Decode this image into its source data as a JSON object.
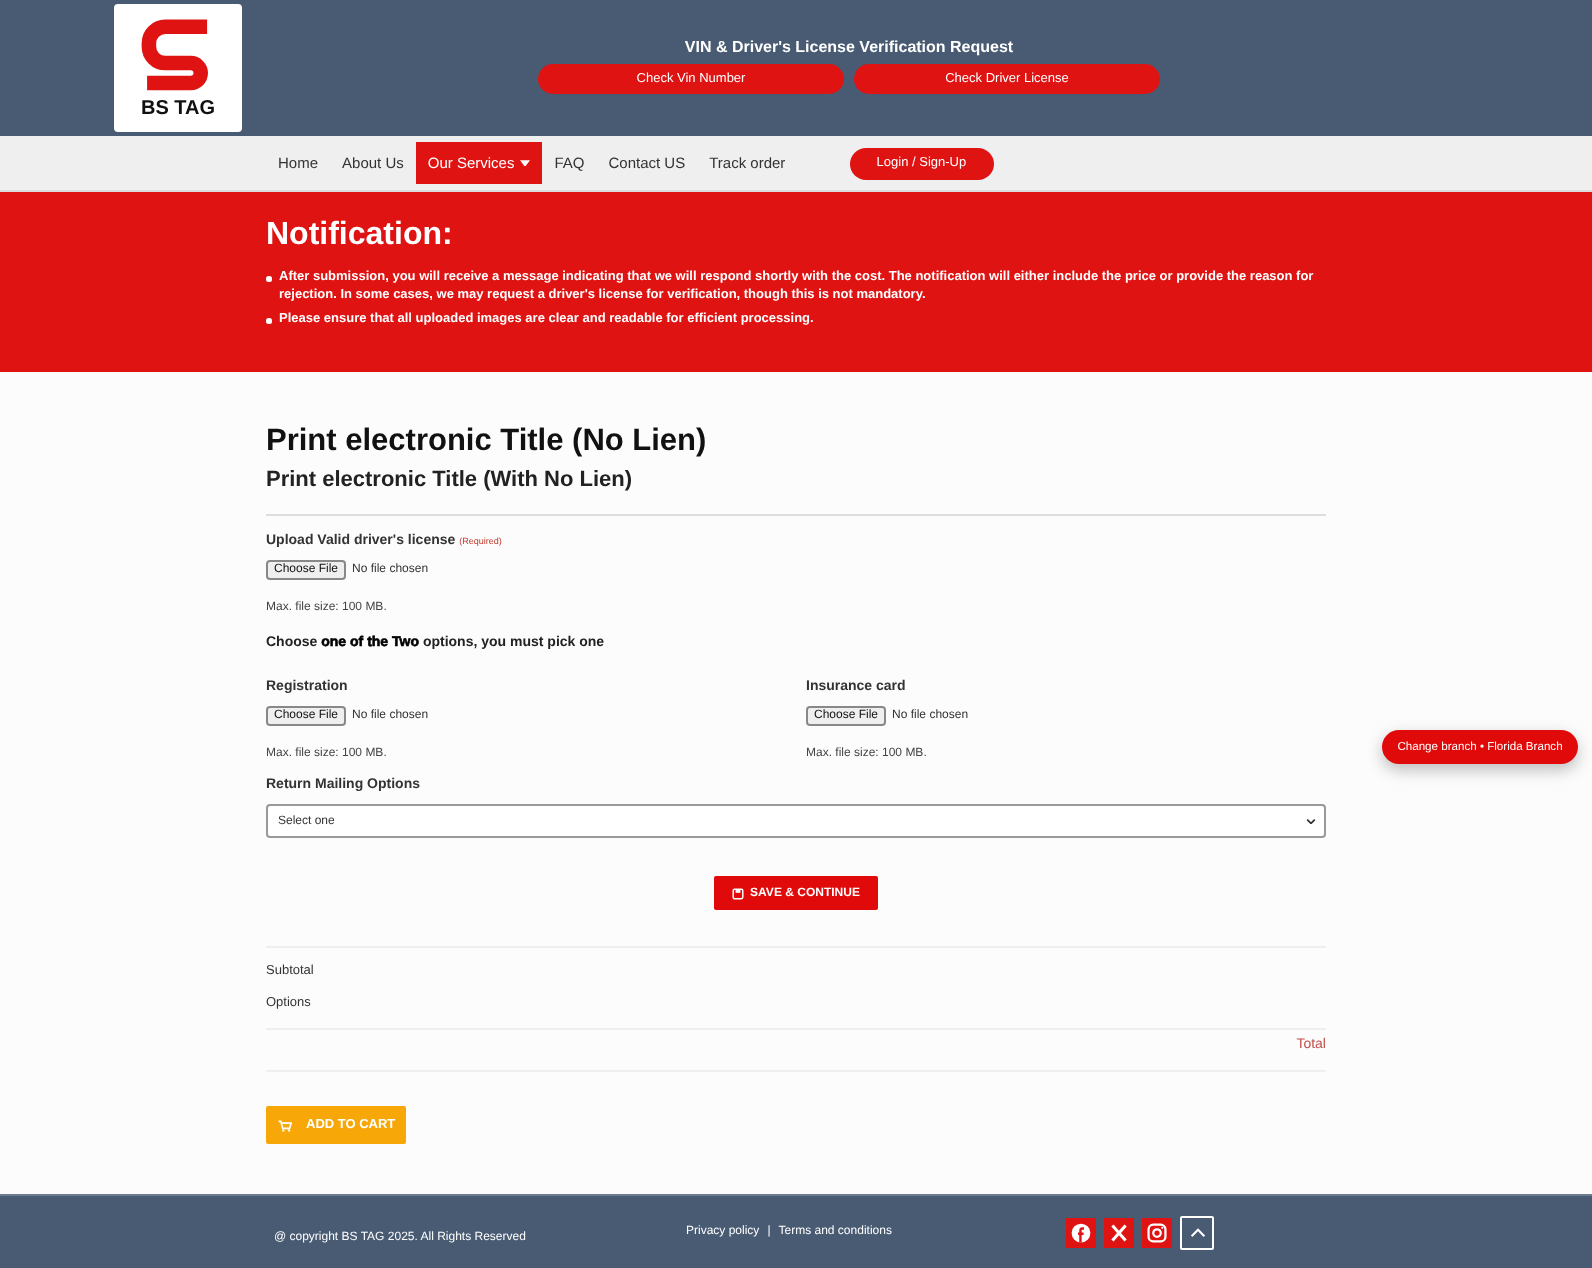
{
  "header": {
    "logo_text": "BS TAG",
    "title": "VIN & Driver's License Verification Request",
    "buttons": [
      "Check Vin Number",
      "Check Driver License"
    ]
  },
  "nav": {
    "items": [
      {
        "label": "Home",
        "selected": false,
        "has_dropdown": false
      },
      {
        "label": "About Us",
        "selected": false,
        "has_dropdown": false
      },
      {
        "label": "Our Services",
        "selected": true,
        "has_dropdown": true
      },
      {
        "label": "FAQ",
        "selected": false,
        "has_dropdown": false
      },
      {
        "label": "Contact US",
        "selected": false,
        "has_dropdown": false
      },
      {
        "label": "Track order",
        "selected": false,
        "has_dropdown": false
      }
    ],
    "login_button": "Login / Sign-Up"
  },
  "notification": {
    "title": "Notification:",
    "items": [
      "After submission, you will receive a message indicating that we will respond shortly with the cost. The notification will either include the price or provide the reason for rejection. In some cases, we may request a driver's license for verification, though this is not mandatory.",
      "Please ensure that all uploaded images are clear and readable for efficient processing."
    ]
  },
  "product": {
    "title": "Print electronic Title (No Lien)",
    "subtitle": "Print electronic Title (With No Lien)"
  },
  "license_upload": {
    "label": "Upload Valid driver's license",
    "required_note": "(Required)",
    "button": "Choose File",
    "status": "No file chosen",
    "hint": "Max. file size: 100 MB."
  },
  "choice_note": "Choose **one of the Two** options, you must pick one",
  "choice_uploads": [
    {
      "label": "Registration",
      "button": "Choose File",
      "status": "No file chosen",
      "hint": "Max. file size: 100 MB."
    },
    {
      "label": "Insurance card",
      "button": "Choose File",
      "status": "No file chosen",
      "hint": "Max. file size: 100 MB."
    }
  ],
  "mailing": {
    "label": "Return Mailing Options",
    "value": "Select one"
  },
  "save_button": "SAVE & CONTINUE",
  "totals": {
    "rows": [
      "Subtotal",
      "Options"
    ],
    "total_label": "Total"
  },
  "add_to_cart_button": "ADD TO CART",
  "branch_button": "Change branch • Florida Branch",
  "footer": {
    "copyright": "@ copyright BS TAG 2025. All Rights Reserved",
    "links": [
      "Privacy policy",
      "Terms and conditions"
    ],
    "separator": "|"
  }
}
